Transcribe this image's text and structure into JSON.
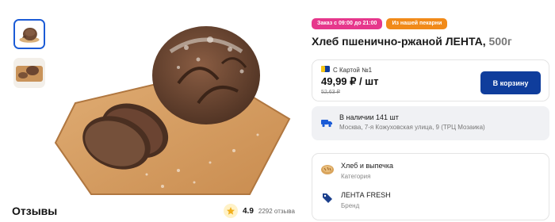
{
  "gallery": {
    "thumbnails": [
      {
        "alt": "bread-round-loaf",
        "active": true
      },
      {
        "alt": "bread-on-board",
        "active": false
      }
    ]
  },
  "reviews": {
    "title": "Отзывы",
    "rating": "4.9",
    "count": "2292 отзыва"
  },
  "badges": [
    {
      "label": "Заказ с 09:00 до 21:00",
      "color": "#e6378c"
    },
    {
      "label": "Из нашей пекарни",
      "color": "#f18a19"
    }
  ],
  "product": {
    "title": "Хлеб пшенично-ржаной ЛЕНТА,",
    "weight": "500г"
  },
  "price_card": {
    "card_label": "С Картой №1",
    "price": "49,99 ₽",
    "unit": "/ шт",
    "old_price": "52,63 ₽",
    "cart_button": "В корзину",
    "button_color": "#0f3d9c"
  },
  "availability": {
    "stock": "В наличии 141 шт",
    "address": "Москва, 7-я Кожуховская улица, 9 (ТРЦ Мозаика)",
    "icon": "delivery-truck-icon"
  },
  "info": {
    "category": {
      "value": "Хлеб и выпечка",
      "label": "Категория",
      "icon": "bread-icon"
    },
    "brand": {
      "value": "ЛЕНТА FRESH",
      "label": "Бренд",
      "icon": "tag-icon"
    }
  },
  "colors": {
    "accent": "#1b5bd6",
    "primary_button": "#0f3d9c",
    "pink_badge": "#e6378c",
    "orange_badge": "#f18a19"
  }
}
